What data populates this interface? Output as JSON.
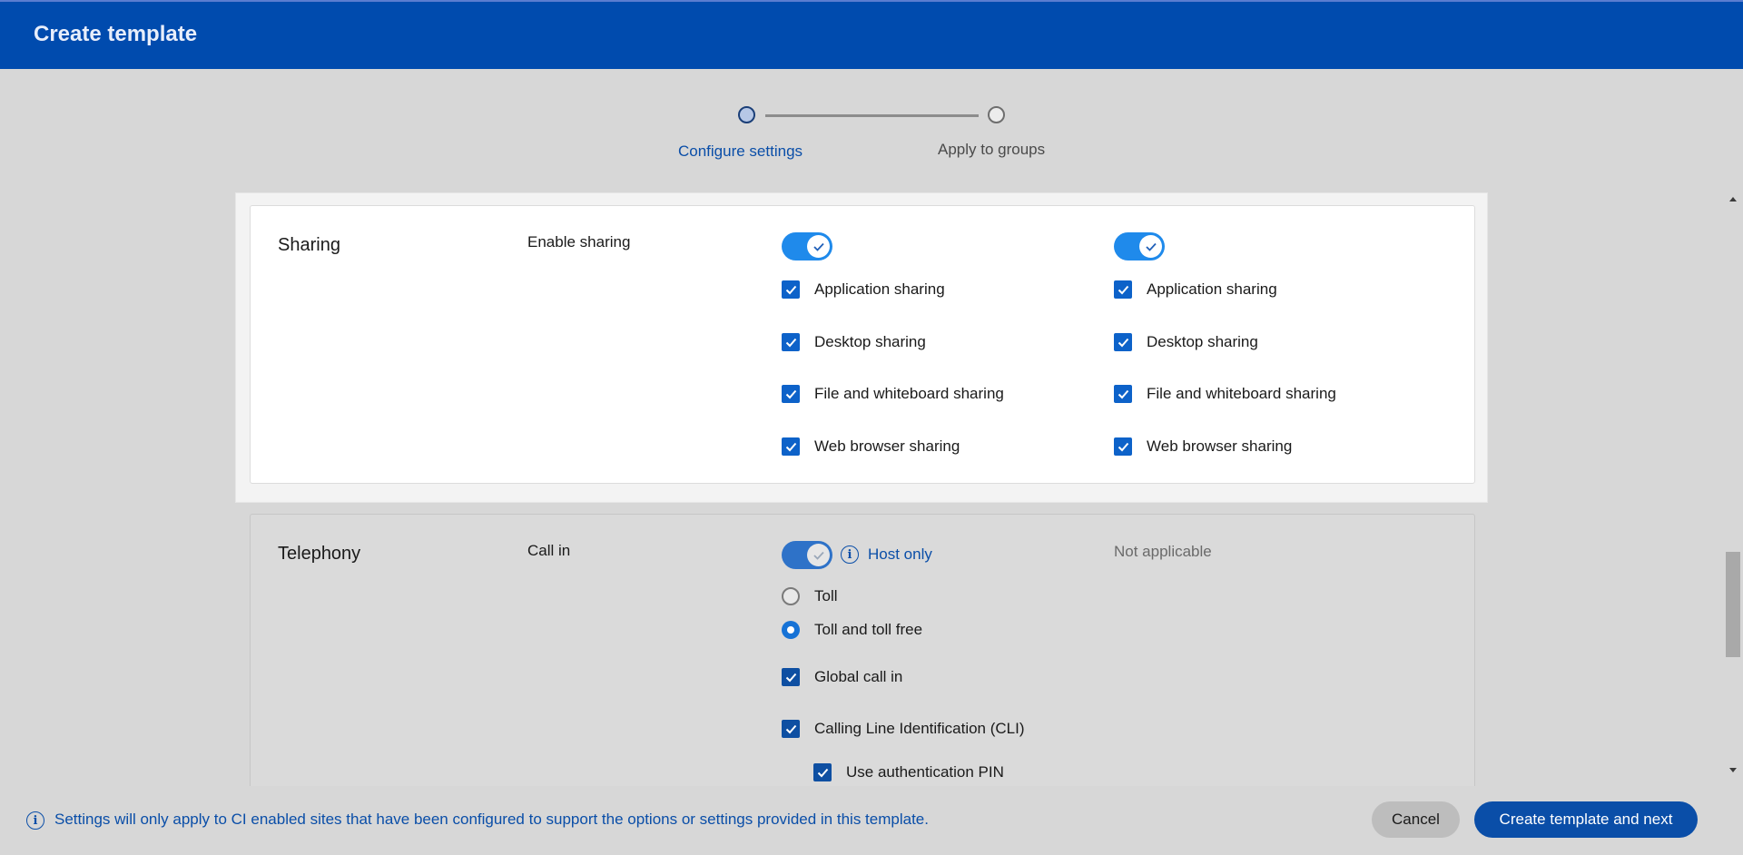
{
  "header": {
    "title": "Create template"
  },
  "stepper": {
    "steps": [
      {
        "label": "Configure settings",
        "state": "active"
      },
      {
        "label": "Apply to groups",
        "state": "inactive"
      }
    ]
  },
  "sections": {
    "sharing": {
      "title": "Sharing",
      "setting_name": "Enable sharing",
      "columns": [
        {
          "toggle_on": true,
          "options": [
            "Application sharing",
            "Desktop sharing",
            "File and whiteboard sharing",
            "Web browser sharing"
          ]
        },
        {
          "toggle_on": true,
          "options": [
            "Application sharing",
            "Desktop sharing",
            "File and whiteboard sharing",
            "Web browser sharing"
          ]
        }
      ]
    },
    "telephony": {
      "title": "Telephony",
      "setting_name": "Call in",
      "host_only_label": "Host only",
      "radio_options": [
        {
          "label": "Toll",
          "selected": false
        },
        {
          "label": "Toll and toll free",
          "selected": true
        }
      ],
      "checks": [
        "Global call in",
        "Calling Line Identification (CLI)"
      ],
      "sub_check": "Use authentication PIN",
      "second_column": "Not applicable"
    }
  },
  "footer": {
    "note": "Settings will only apply to CI enabled sites that have been configured to support the options or settings provided in this template.",
    "cancel_label": "Cancel",
    "primary_label": "Create template and next"
  },
  "colors": {
    "brand": "#004bae",
    "accent": "#0d62c9",
    "toggle": "#1f8aeb"
  }
}
